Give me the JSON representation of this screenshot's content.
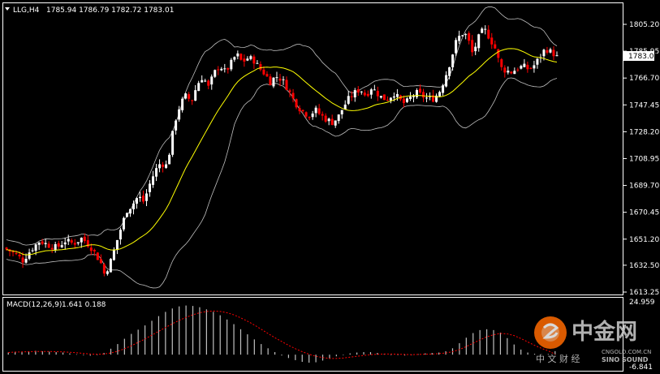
{
  "chart_header": {
    "symbol_tf": "LLG,H4",
    "ohlc": "1785.94 1786.79 1782.72 1783.01"
  },
  "macd_header": {
    "label": "MACD(12,26,9)",
    "values": "1.641 0.188"
  },
  "watermark": {
    "brand_cn": "中金网",
    "brand_sub": "中 文 财 经",
    "brand_en": "SINO SOUND",
    "domain": "CNGOLD.COM.CN"
  },
  "colors": {
    "background": "#000000",
    "bull_candle": "#ffffff",
    "bear_candle": "#ff0000",
    "ma_line": "#ffff00",
    "bands": "#c0c0c0",
    "macd_hist": "#c0c0c0",
    "macd_signal": "#ff0000",
    "price_label_bg": "#ffffff"
  },
  "chart_data": [
    {
      "type": "candlestick",
      "title": "LLG,H4",
      "indicators": [
        "Bollinger Bands",
        "Moving Average (yellow)"
      ],
      "y_ticks": [
        "1805.20",
        "1785.95",
        "1766.70",
        "1747.45",
        "1728.20",
        "1708.95",
        "1689.70",
        "1670.45",
        "1651.20",
        "1632.50",
        "1613.25"
      ],
      "ylim": [
        1613.25,
        1805.2
      ],
      "last_price": "1783.01",
      "grid": false,
      "close_path": [
        [
          0,
          1645
        ],
        [
          8,
          1641
        ],
        [
          14,
          1636
        ],
        [
          20,
          1644
        ],
        [
          26,
          1650
        ],
        [
          32,
          1647
        ],
        [
          38,
          1645
        ],
        [
          44,
          1650
        ],
        [
          50,
          1648
        ],
        [
          56,
          1652
        ],
        [
          62,
          1646
        ],
        [
          66,
          1640
        ],
        [
          70,
          1633
        ],
        [
          72,
          1626
        ],
        [
          76,
          1634
        ],
        [
          80,
          1647
        ],
        [
          84,
          1660
        ],
        [
          88,
          1672
        ],
        [
          92,
          1676
        ],
        [
          96,
          1682
        ],
        [
          100,
          1678
        ],
        [
          104,
          1690
        ],
        [
          108,
          1700
        ],
        [
          112,
          1706
        ],
        [
          116,
          1704
        ],
        [
          118,
          1712
        ],
        [
          122,
          1735
        ],
        [
          126,
          1748
        ],
        [
          130,
          1754
        ],
        [
          134,
          1750
        ],
        [
          138,
          1762
        ],
        [
          142,
          1768
        ],
        [
          146,
          1760
        ],
        [
          150,
          1770
        ],
        [
          154,
          1776
        ],
        [
          158,
          1771
        ],
        [
          162,
          1777
        ],
        [
          166,
          1784
        ],
        [
          170,
          1778
        ],
        [
          174,
          1781
        ],
        [
          178,
          1780
        ],
        [
          182,
          1774
        ],
        [
          186,
          1770
        ],
        [
          190,
          1764
        ],
        [
          194,
          1768
        ],
        [
          198,
          1766
        ],
        [
          202,
          1760
        ],
        [
          206,
          1752
        ],
        [
          210,
          1746
        ],
        [
          214,
          1742
        ],
        [
          218,
          1740
        ],
        [
          222,
          1744
        ],
        [
          226,
          1740
        ],
        [
          230,
          1737
        ],
        [
          234,
          1735
        ],
        [
          238,
          1738
        ],
        [
          242,
          1746
        ],
        [
          246,
          1752
        ],
        [
          250,
          1756
        ],
        [
          254,
          1759
        ],
        [
          258,
          1754
        ],
        [
          262,
          1760
        ],
        [
          266,
          1756
        ],
        [
          270,
          1752
        ],
        [
          274,
          1752
        ],
        [
          278,
          1756
        ],
        [
          282,
          1751
        ],
        [
          286,
          1748
        ],
        [
          290,
          1753
        ],
        [
          294,
          1756
        ],
        [
          298,
          1754
        ],
        [
          302,
          1752
        ],
        [
          306,
          1752
        ],
        [
          310,
          1756
        ],
        [
          314,
          1766
        ],
        [
          318,
          1778
        ],
        [
          322,
          1792
        ],
        [
          326,
          1799
        ],
        [
          330,
          1797
        ],
        [
          334,
          1784
        ],
        [
          338,
          1795
        ],
        [
          342,
          1802
        ],
        [
          346,
          1796
        ],
        [
          350,
          1788
        ],
        [
          354,
          1774
        ],
        [
          358,
          1772
        ],
        [
          362,
          1771
        ],
        [
          366,
          1774
        ],
        [
          370,
          1775
        ],
        [
          374,
          1773
        ],
        [
          378,
          1776
        ],
        [
          382,
          1782
        ],
        [
          386,
          1788
        ],
        [
          390,
          1785
        ],
        [
          394,
          1783.01
        ]
      ]
    },
    {
      "type": "bar",
      "title": "MACD(12,26,9)",
      "y_ticks": [
        "24.959",
        "-6.841"
      ],
      "ylim": [
        -6.841,
        24.959
      ],
      "main": [
        1.0,
        1.4,
        1.2,
        1.6,
        1.8,
        1.6,
        1.4,
        1.2,
        1.0,
        0.6,
        0.2,
        -0.3,
        -0.5,
        -0.2,
        0.8,
        2.8,
        5.0,
        7.5,
        9.8,
        11.8,
        13.8,
        16.0,
        18.2,
        20.2,
        21.8,
        22.8,
        23.2,
        23.0,
        22.4,
        21.4,
        20.2,
        18.6,
        16.6,
        14.4,
        12.0,
        9.6,
        7.2,
        5.0,
        3.0,
        1.2,
        -0.4,
        -1.6,
        -2.6,
        -3.4,
        -3.8,
        -3.6,
        -2.8,
        -1.8,
        -0.8,
        0.0,
        0.6,
        1.0,
        1.2,
        1.2,
        0.8,
        0.4,
        0.0,
        -0.2,
        -0.4,
        -0.2,
        0.2,
        0.6,
        0.8,
        1.0,
        1.6,
        3.0,
        5.4,
        8.0,
        10.2,
        11.6,
        12.0,
        11.6,
        10.4,
        7.8,
        4.8,
        2.4,
        1.0,
        0.4,
        0.2,
        0.3,
        1.641
      ],
      "signal": [
        1.0,
        1.2,
        1.3,
        1.4,
        1.5,
        1.5,
        1.5,
        1.4,
        1.3,
        1.1,
        0.9,
        0.6,
        0.3,
        0.2,
        0.3,
        0.8,
        1.6,
        2.8,
        4.2,
        5.8,
        7.4,
        9.2,
        11.0,
        12.8,
        14.6,
        16.2,
        17.6,
        18.8,
        19.8,
        20.4,
        20.6,
        20.4,
        19.8,
        18.8,
        17.4,
        15.8,
        14.0,
        12.0,
        10.0,
        8.0,
        6.2,
        4.4,
        2.8,
        1.4,
        0.2,
        -0.8,
        -1.4,
        -1.8,
        -1.8,
        -1.6,
        -1.2,
        -0.8,
        -0.4,
        0.0,
        0.2,
        0.3,
        0.3,
        0.2,
        0.1,
        0.0,
        0.1,
        0.2,
        0.3,
        0.5,
        0.8,
        1.4,
        2.4,
        3.8,
        5.4,
        7.0,
        8.4,
        9.4,
        10.0,
        9.8,
        9.0,
        7.6,
        6.0,
        4.4,
        3.0,
        1.8,
        0.188
      ]
    }
  ]
}
